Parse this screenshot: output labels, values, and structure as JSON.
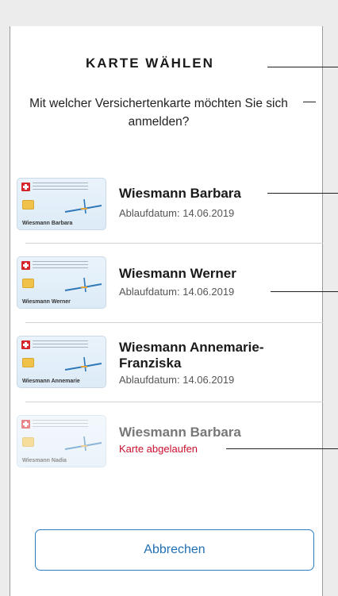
{
  "title": "KARTE WÄHLEN",
  "subtitle": "Mit welcher Versichertenkarte möchten Sie sich anmelden?",
  "cards": [
    {
      "card_holder": "Wiesmann Barbara",
      "name": "Wiesmann Barbara",
      "status": "Ablaufdatum: 14.06.2019",
      "expired": false
    },
    {
      "card_holder": "Wiesmann Werner",
      "name": "Wiesmann Werner",
      "status": "Ablaufdatum: 14.06.2019",
      "expired": false
    },
    {
      "card_holder": "Wiesmann Annemarie",
      "name": "Wiesmann Annemarie-Franziska",
      "status": "Ablaufdatum: 14.06.2019",
      "expired": false
    },
    {
      "card_holder": "Wiesmann Nadia",
      "name": "Wiesmann Barbara",
      "status": "Karte abgelaufen",
      "expired": true
    }
  ],
  "cancel_label": "Abbrechen",
  "colors": {
    "accent": "#1f6fb5",
    "expired": "#c8102e",
    "flag": "#d6262c"
  }
}
